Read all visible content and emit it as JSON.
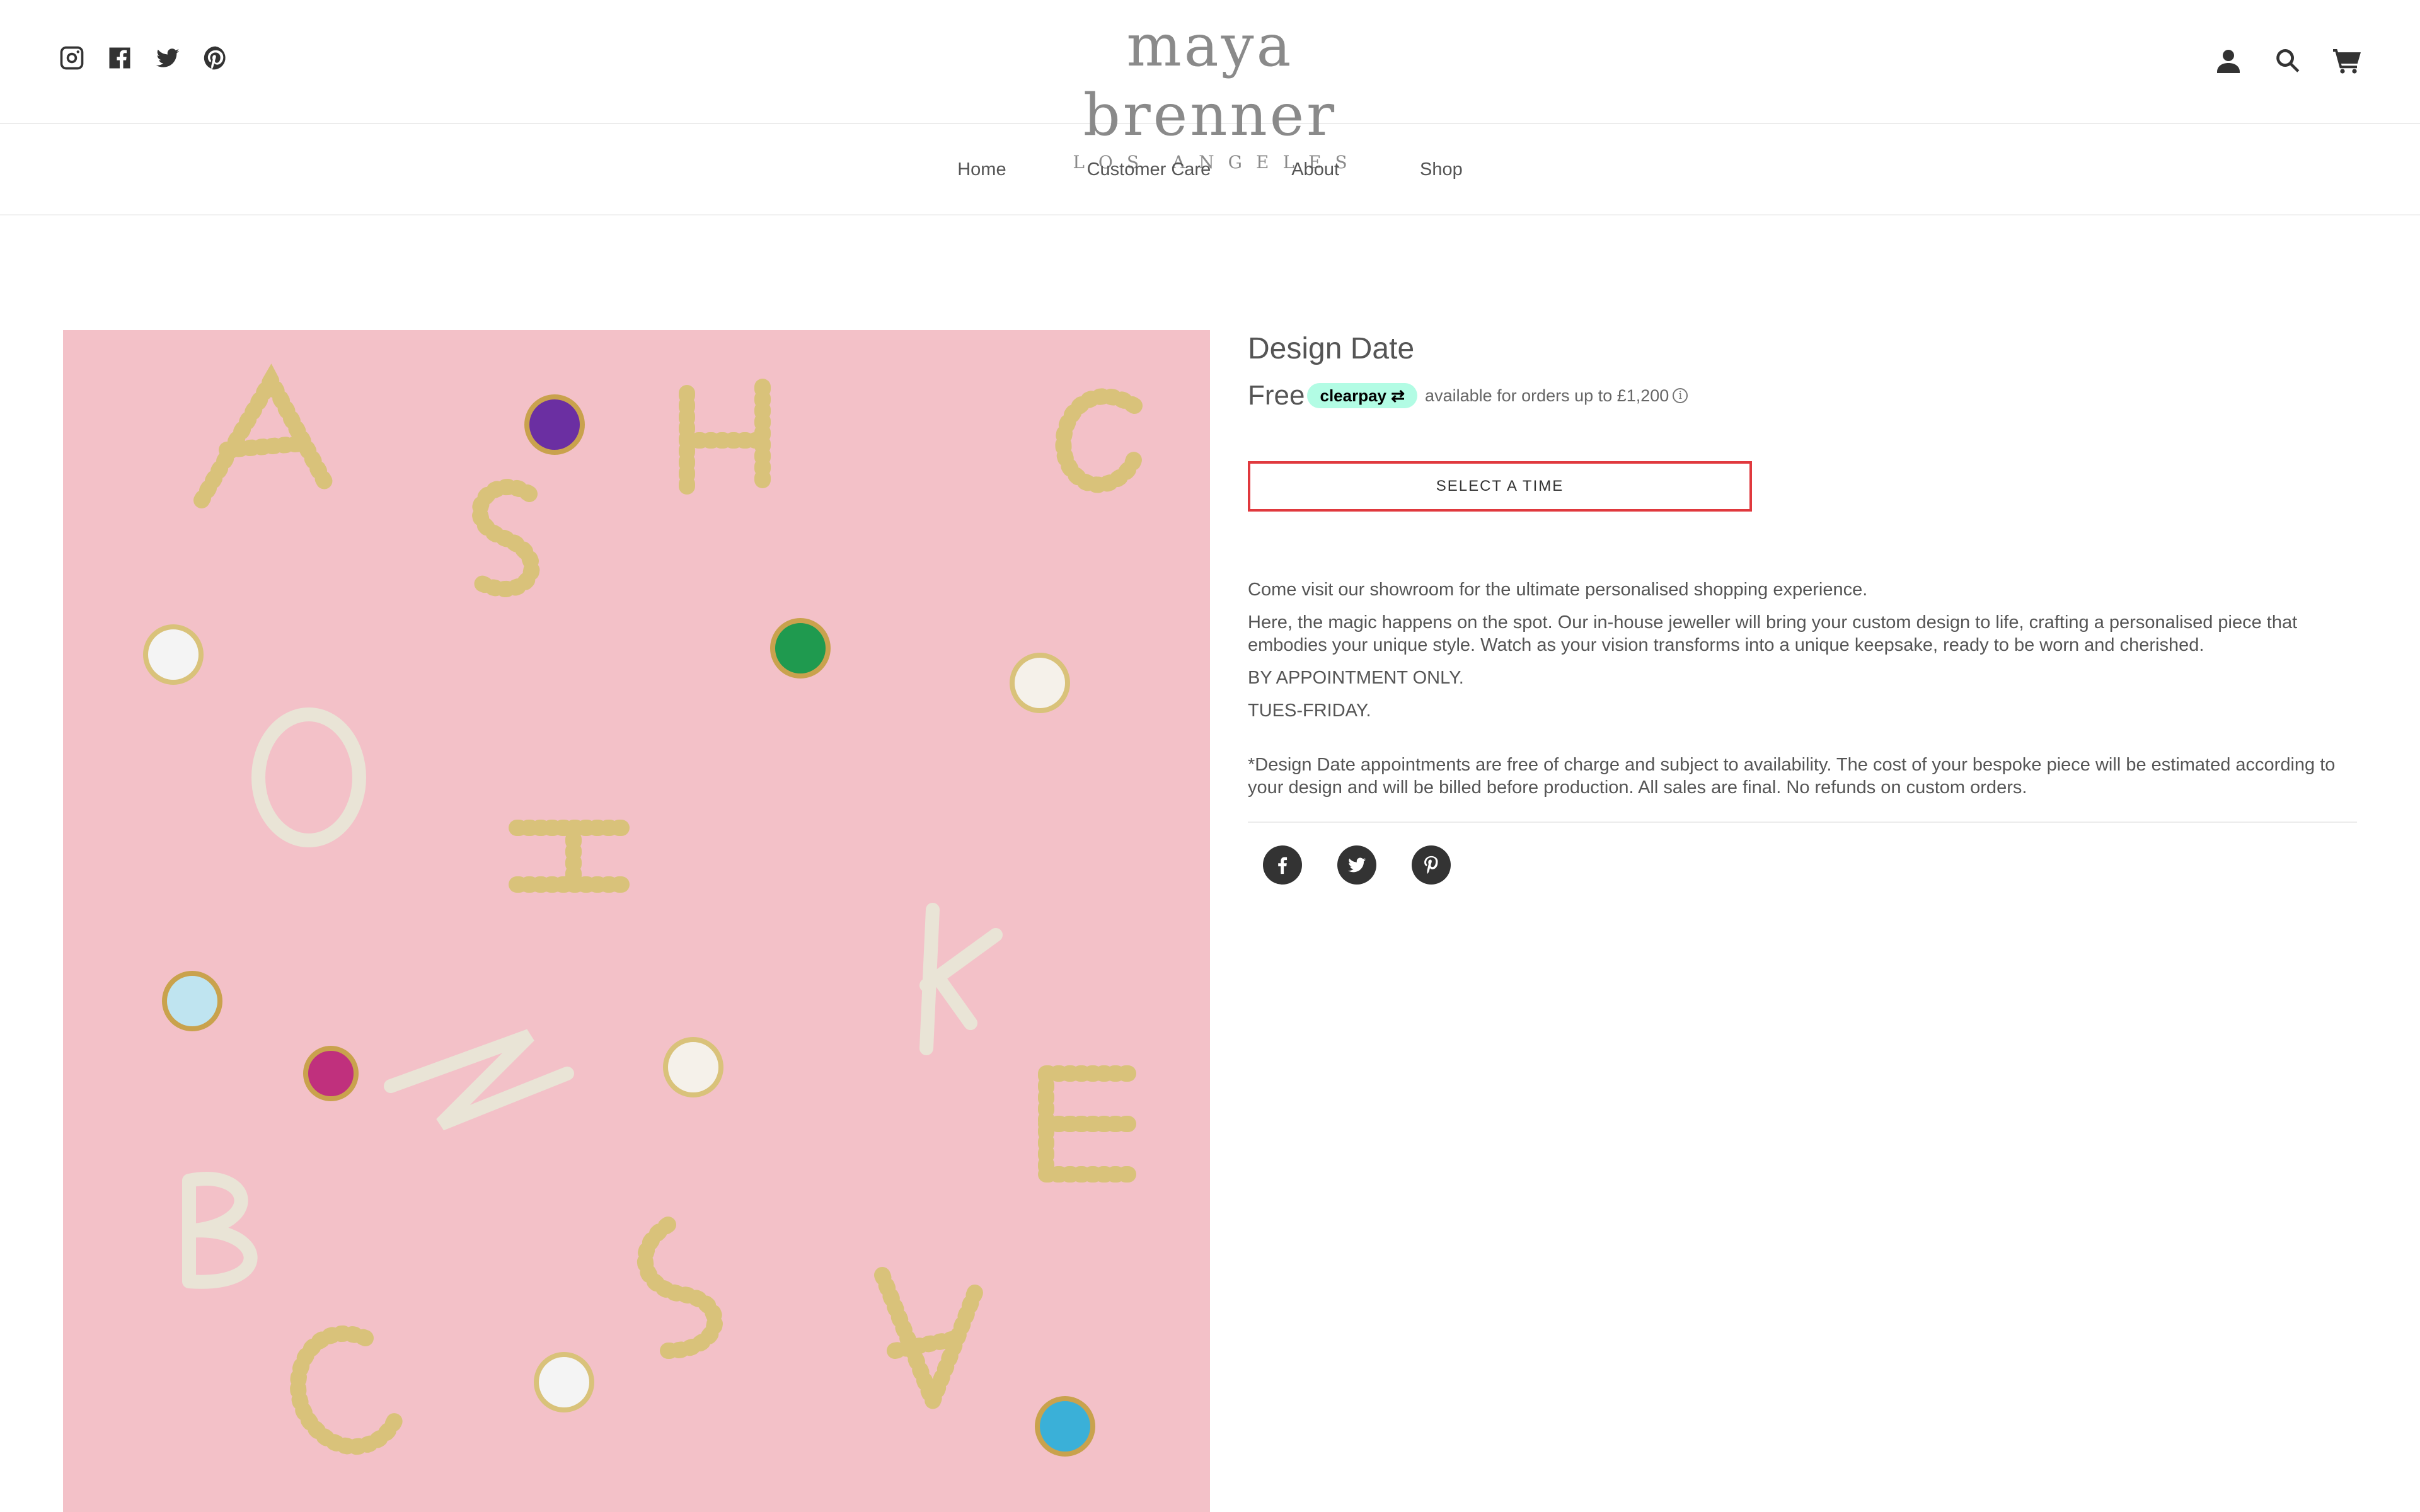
{
  "header": {
    "social_icons": [
      "instagram-icon",
      "facebook-icon",
      "twitter-icon",
      "pinterest-icon"
    ],
    "logo": {
      "main": "maya brenner",
      "sub": "LOS ANGELES"
    },
    "right_icons": [
      "account-icon",
      "search-icon",
      "cart-icon"
    ]
  },
  "nav": {
    "items": [
      "Home",
      "Customer Care",
      "About",
      "Shop"
    ]
  },
  "product": {
    "title": "Design Date",
    "price": "Free",
    "clearpay_badge": "clearpay",
    "clearpay_note": "available for orders up to £1,200",
    "select_button": "SELECT A TIME",
    "description": [
      "Come visit our showroom for the ultimate personalised shopping experience.",
      "Here, the magic happens on the spot. Our in-house jeweller will bring your custom design to life, crafting a personalised piece that embodies your unique style. Watch as your vision transforms into a unique keepsake, ready to be worn and cherished.",
      "BY APPOINTMENT ONLY.",
      "TUES-FRIDAY."
    ],
    "disclaimer": "*Design Date appointments are free of charge and subject to availability.  The cost of your bespoke piece will be estimated according to your design and will be billed before production.  All sales are final.  No refunds on custom orders.",
    "share_icons": [
      "facebook-icon",
      "twitter-icon",
      "pinterest-icon"
    ]
  },
  "colors": {
    "image_background": "#f3c1c8",
    "button_border": "#e0393e",
    "clearpay_badge": "#b2fce4",
    "text": "#555555"
  }
}
